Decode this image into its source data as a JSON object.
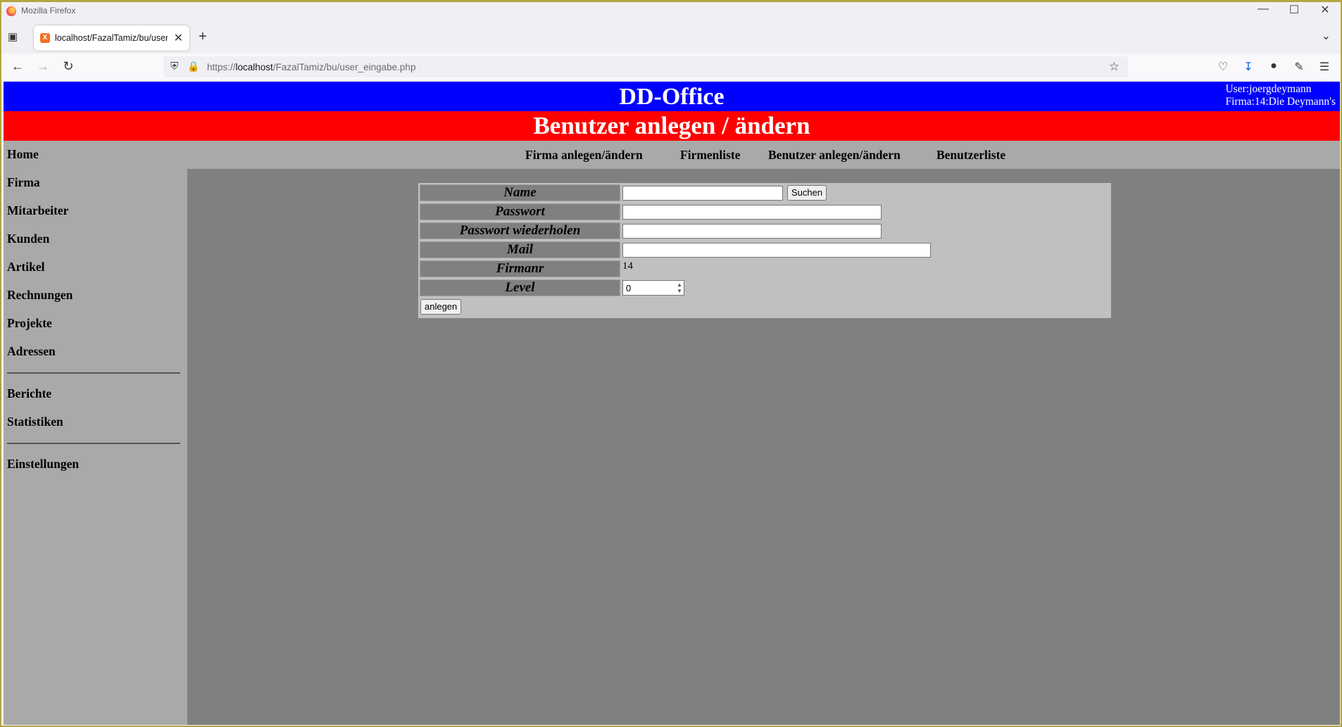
{
  "browser": {
    "window_title": "Mozilla Firefox",
    "tab_title": "localhost/FazalTamiz/bu/user_e",
    "url_prefix": "https://",
    "url_host": "localhost",
    "url_path": "/FazalTamiz/bu/user_eingabe.php"
  },
  "header": {
    "app_title": "DD-Office",
    "user_line": "User:joergdeymann",
    "company_line": "Firma:14:Die Deymann's",
    "page_heading": "Benutzer anlegen / ändern"
  },
  "sidebar": {
    "items": [
      "Home",
      "Firma",
      "Mitarbeiter",
      "Kunden",
      "Artikel",
      "Rechnungen",
      "Projekte",
      "Adressen"
    ],
    "items2": [
      "Berichte",
      "Statistiken"
    ],
    "items3": [
      "Einstellungen"
    ]
  },
  "topnav": {
    "links": [
      "Firma anlegen/ändern",
      "Firmenliste",
      "Benutzer anlegen/ändern",
      "Benutzerliste"
    ]
  },
  "form": {
    "labels": {
      "name": "Name",
      "password": "Passwort",
      "password_repeat": "Passwort wiederholen",
      "mail": "Mail",
      "firmanr": "Firmanr",
      "level": "Level"
    },
    "values": {
      "name": "",
      "password": "",
      "password_repeat": "",
      "mail": "",
      "firmanr": "14",
      "level": "0"
    },
    "search_button": "Suchen",
    "submit_button": "anlegen"
  },
  "colors": {
    "top_band": "#0000ff",
    "heading_band": "#ff0000",
    "sidebar": "#a9a9a9",
    "content": "#808080",
    "form_bg": "#c0c0c0"
  }
}
